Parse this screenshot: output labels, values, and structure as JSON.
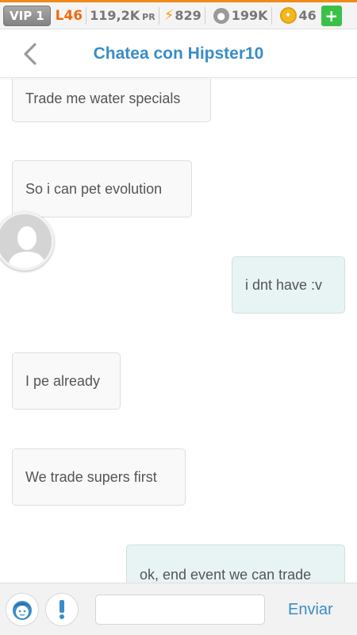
{
  "status_bar": {
    "vip_label": "VIP",
    "vip_level": "1",
    "player_level": "L46",
    "pr_value": "119,2K",
    "pr_unit": "PR",
    "energy": "829",
    "paws": "199K",
    "coins": "46",
    "add_label": "+",
    "colors": {
      "level": "#f06a10",
      "energy": "#f0a010",
      "add": "#3bc14a"
    }
  },
  "header": {
    "title": "Chatea con Hipster10",
    "back_icon": "chevron-left-icon",
    "title_color": "#3a8dc8"
  },
  "messages": [
    {
      "side": "in",
      "text": "Trade me water specials"
    },
    {
      "side": "in",
      "text": "So i can pet evolution"
    },
    {
      "side": "out",
      "text": "i dnt have :v"
    },
    {
      "side": "in",
      "text": "I pe already"
    },
    {
      "side": "in",
      "text": "We trade supers first"
    },
    {
      "side": "out",
      "text": "ok, end event we can trade"
    }
  ],
  "input_bar": {
    "profile_icon": "profile-face-icon",
    "report_icon": "exclamation-icon",
    "message_value": "",
    "send_label": "Enviar"
  }
}
